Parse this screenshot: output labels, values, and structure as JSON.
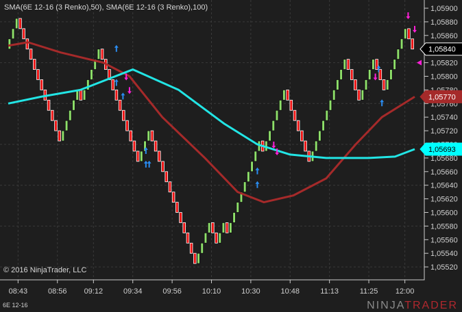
{
  "chart_data": {
    "type": "renko",
    "title": "SMA(6E 12-16 (3 Renko),50), SMA(6E 12-16 (3 Renko),100)",
    "instrument": "6E 12-16",
    "copyright": "© 2016 NinjaTrader, LLC",
    "logo": "NINJATRADER",
    "brick_size": 0.00015,
    "ylim": [
      1.0551,
      1.0592
    ],
    "y_ticks": [
      "1,05900",
      "1,05880",
      "1,05860",
      "1,05840",
      "1,05820",
      "1,05800",
      "1,05780",
      "1,05760",
      "1,05740",
      "1,05720",
      "1,05700",
      "1,05680",
      "1,05660",
      "1,05640",
      "1,05620",
      "1,05600",
      "1,05580",
      "1,05560",
      "1,05540",
      "1,05520"
    ],
    "y_tick_values": [
      1.059,
      1.0588,
      1.0586,
      1.0584,
      1.0582,
      1.058,
      1.0578,
      1.0576,
      1.0574,
      1.0572,
      1.057,
      1.0568,
      1.0566,
      1.0564,
      1.0562,
      1.056,
      1.0558,
      1.0556,
      1.0554,
      1.0552
    ],
    "x_ticks": [
      "08:43",
      "08:56",
      "09:12",
      "09:34",
      "09:56",
      "10:10",
      "10:30",
      "10:48",
      "11:13",
      "11:25",
      "12:00"
    ],
    "x_tick_bars": [
      3,
      15,
      26,
      38,
      50,
      62,
      74,
      86,
      98,
      110,
      121
    ],
    "bar_count": 124,
    "price_swings": [
      [
        0,
        1.0584
      ],
      [
        2,
        1.0588
      ],
      [
        14,
        1.057
      ],
      [
        19,
        1.0578
      ],
      [
        21,
        1.0576
      ],
      [
        31,
        1.0584
      ],
      [
        34,
        1.058
      ],
      [
        41,
        1.0568
      ],
      [
        46,
        1.0572
      ],
      [
        59,
        1.0553
      ],
      [
        62,
        1.0558
      ],
      [
        66,
        1.0556
      ],
      [
        69,
        1.0558
      ],
      [
        72,
        1.0557
      ],
      [
        80,
        1.057
      ],
      [
        82,
        1.0569
      ],
      [
        87,
        1.0578
      ],
      [
        95,
        1.0567
      ],
      [
        104,
        1.0583
      ],
      [
        108,
        1.0576
      ],
      [
        114,
        1.0582
      ],
      [
        116,
        1.0578
      ],
      [
        123,
        1.0587
      ],
      [
        124,
        1.0584
      ]
    ],
    "series": [
      {
        "name": "SMA(6E 12-16 (3 Renko),50)",
        "color": "#a52a2a",
        "points": [
          [
            0,
            1.05845
          ],
          [
            6,
            1.0585
          ],
          [
            16,
            1.05835
          ],
          [
            29,
            1.0582
          ],
          [
            37,
            1.058
          ],
          [
            47,
            1.0574
          ],
          [
            60,
            1.0568
          ],
          [
            70,
            1.0563
          ],
          [
            78,
            1.05615
          ],
          [
            87,
            1.05625
          ],
          [
            97,
            1.0565
          ],
          [
            106,
            1.057
          ],
          [
            114,
            1.0574
          ],
          [
            124,
            1.0577
          ]
        ]
      },
      {
        "name": "SMA(6E 12-16 (3 Renko),100)",
        "color": "#22e5e5",
        "points": [
          [
            0,
            1.0576
          ],
          [
            10,
            1.0577
          ],
          [
            22,
            1.0578
          ],
          [
            38,
            1.0581
          ],
          [
            52,
            1.0578
          ],
          [
            66,
            1.0573
          ],
          [
            76,
            1.057
          ],
          [
            86,
            1.05685
          ],
          [
            97,
            1.0568
          ],
          [
            110,
            1.0568
          ],
          [
            118,
            1.05682
          ],
          [
            124,
            1.05693
          ]
        ]
      }
    ],
    "markers": [
      {
        "bar": 33,
        "price": 1.0584,
        "dir": "up",
        "color": "#2a8cf0"
      },
      {
        "bar": 33,
        "price": 1.0579,
        "dir": "up",
        "color": "#2a8cf0"
      },
      {
        "bar": 35,
        "price": 1.0577,
        "dir": "up",
        "color": "#2a8cf0"
      },
      {
        "bar": 36,
        "price": 1.058,
        "dir": "down",
        "color": "#ff1fd8"
      },
      {
        "bar": 37,
        "price": 1.0578,
        "dir": "down",
        "color": "#ff1fd8"
      },
      {
        "bar": 42,
        "price": 1.0569,
        "dir": "up",
        "color": "#2a8cf0"
      },
      {
        "bar": 42,
        "price": 1.0567,
        "dir": "up",
        "color": "#2a8cf0"
      },
      {
        "bar": 43,
        "price": 1.0567,
        "dir": "up",
        "color": "#2a8cf0"
      },
      {
        "bar": 76,
        "price": 1.0566,
        "dir": "up",
        "color": "#2a8cf0"
      },
      {
        "bar": 76,
        "price": 1.0564,
        "dir": "up",
        "color": "#2a8cf0"
      },
      {
        "bar": 81,
        "price": 1.057,
        "dir": "down",
        "color": "#ff1fd8"
      },
      {
        "bar": 82,
        "price": 1.0569,
        "dir": "down",
        "color": "#ff1fd8"
      },
      {
        "bar": 112,
        "price": 1.058,
        "dir": "down",
        "color": "#ff1fd8"
      },
      {
        "bar": 113,
        "price": 1.0581,
        "dir": "up",
        "color": "#2a8cf0"
      },
      {
        "bar": 114,
        "price": 1.0576,
        "dir": "up",
        "color": "#2a8cf0"
      },
      {
        "bar": 122,
        "price": 1.0589,
        "dir": "down",
        "color": "#ff1fd8"
      },
      {
        "bar": 124,
        "price": 1.0587,
        "dir": "down",
        "color": "#ff1fd8"
      }
    ],
    "price_markers": [
      {
        "label": "1,05840",
        "value": 1.0584,
        "bg": "#000000",
        "fg": "#ffffff",
        "border": "#ffffff"
      },
      {
        "label": "1,05770",
        "value": 1.0577,
        "bg": "#a52a2a",
        "fg": "#ffffff",
        "border": "#a52a2a"
      },
      {
        "label": "1,05693",
        "value": 1.05693,
        "bg": "#00ffff",
        "fg": "#000000",
        "border": "#00ffff"
      }
    ],
    "up_color": "#8ee06a",
    "down_color": "#ee1111"
  }
}
